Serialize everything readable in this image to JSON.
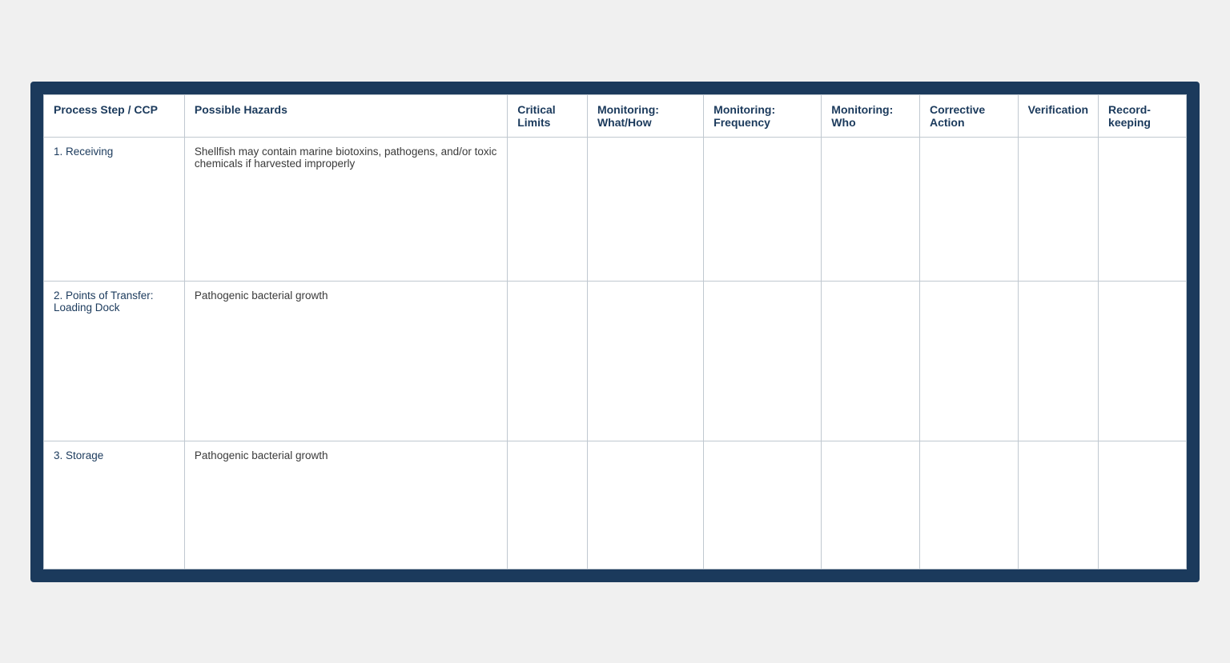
{
  "table": {
    "border_color": "#1b3a5c",
    "headers": [
      {
        "id": "process-step",
        "label": "Process Step / CCP"
      },
      {
        "id": "possible-hazards",
        "label": "Possible Hazards"
      },
      {
        "id": "critical-limits",
        "label": "Critical Limits"
      },
      {
        "id": "monitoring-what",
        "label": "Monitoring: What/How"
      },
      {
        "id": "monitoring-frequency",
        "label": "Monitoring: Frequency"
      },
      {
        "id": "monitoring-who",
        "label": "Monitoring: Who"
      },
      {
        "id": "corrective-action",
        "label": "Corrective Action"
      },
      {
        "id": "verification",
        "label": "Verification"
      },
      {
        "id": "record-keeping",
        "label": "Record-keeping"
      }
    ],
    "rows": [
      {
        "id": "row-receiving",
        "process_step": "1.  Receiving",
        "possible_hazards": "Shellfish may contain marine biotoxins, pathogens, and/or toxic chemicals if harvested improperly",
        "critical_limits": "",
        "monitoring_what": "",
        "monitoring_frequency": "",
        "monitoring_who": "",
        "corrective_action": "",
        "verification": "",
        "record_keeping": ""
      },
      {
        "id": "row-transfer",
        "process_step": "2.  Points of Transfer: Loading Dock",
        "possible_hazards": "Pathogenic bacterial growth",
        "critical_limits": "",
        "monitoring_what": "",
        "monitoring_frequency": "",
        "monitoring_who": "",
        "corrective_action": "",
        "verification": "",
        "record_keeping": ""
      },
      {
        "id": "row-storage",
        "process_step": "3.  Storage",
        "possible_hazards": "Pathogenic bacterial growth",
        "critical_limits": "",
        "monitoring_what": "",
        "monitoring_frequency": "",
        "monitoring_who": "",
        "corrective_action": "",
        "verification": "",
        "record_keeping": ""
      }
    ]
  }
}
